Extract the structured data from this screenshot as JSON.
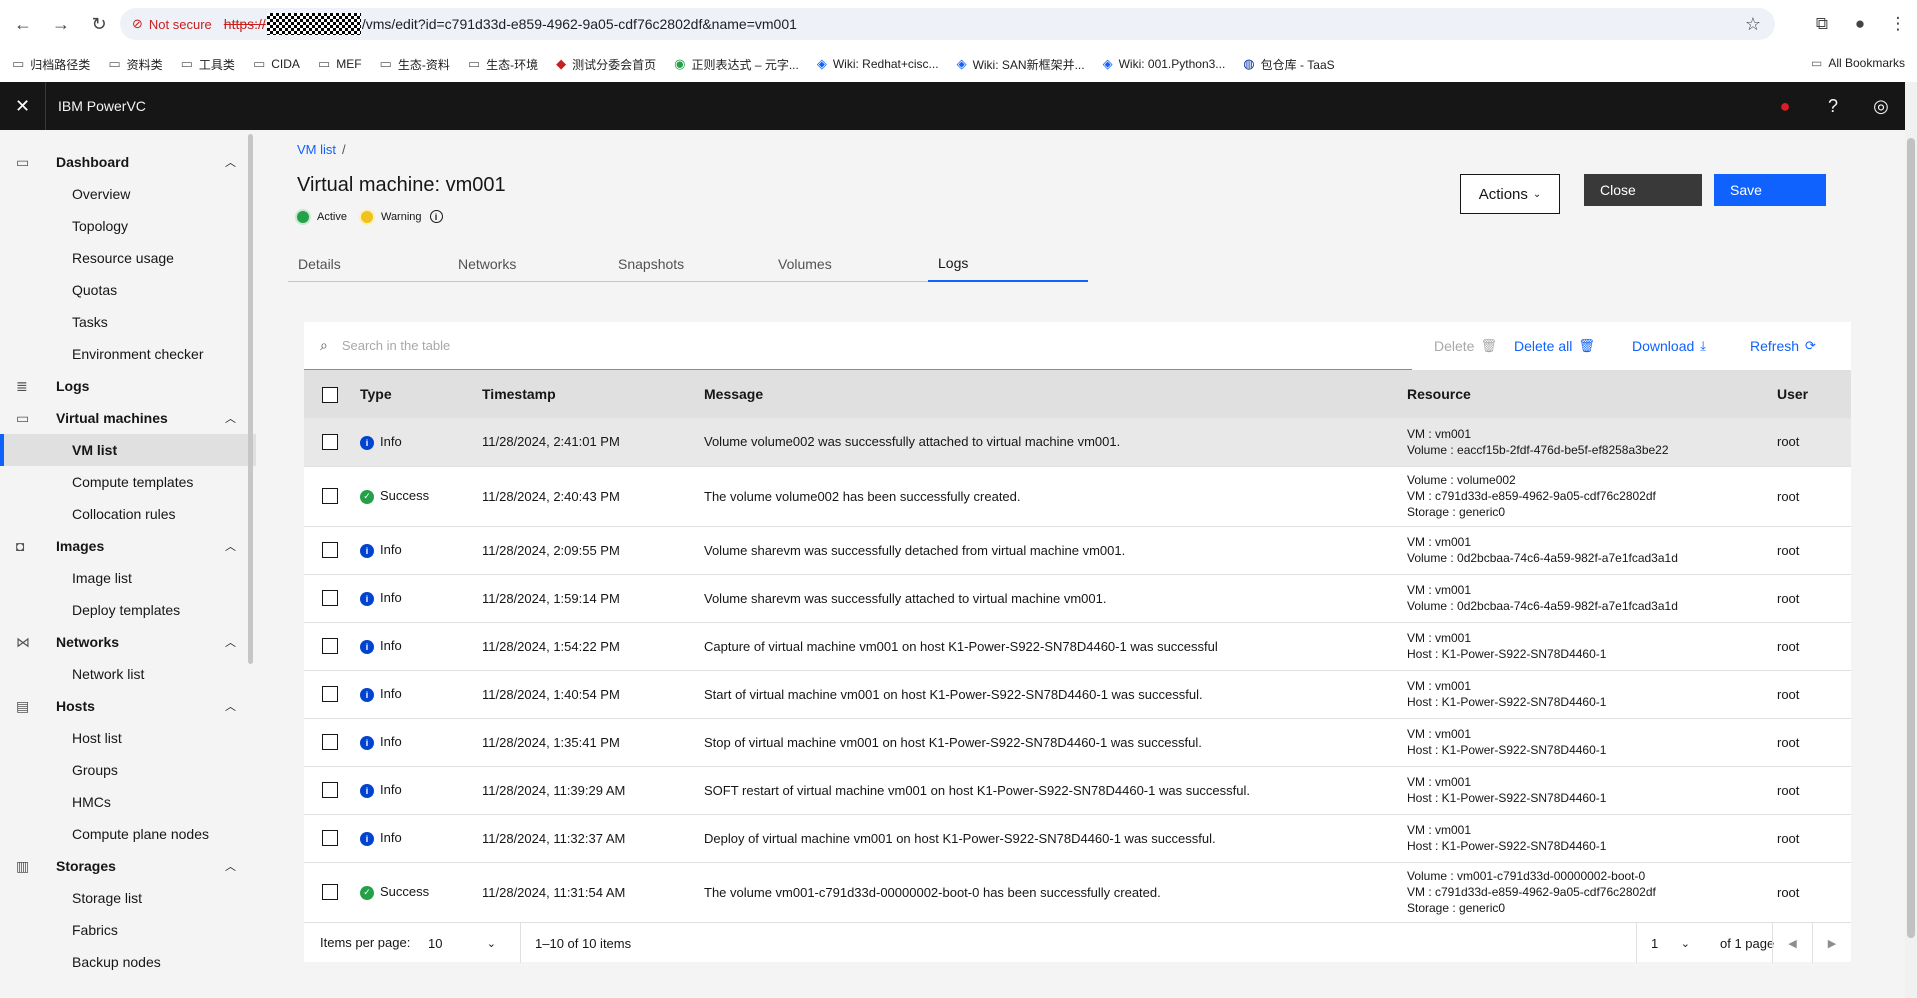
{
  "browser": {
    "not_secure": "Not secure",
    "url_scheme": "https://",
    "url_rest": "/vms/edit?id=c791d33d-e859-4962-9a05-cdf76c2802df&name=vm001",
    "bookmarks": [
      "归档路径类",
      "资料类",
      "工具类",
      "CIDA",
      "MEF",
      "生态-资料",
      "生态-环境",
      "测试分委会首页",
      "正则表达式 – 元字...",
      "Wiki: Redhat+cisc...",
      "Wiki: SAN新框架并...",
      "Wiki: 001.Python3...",
      "包仓库 - TaaS"
    ],
    "all_bookmarks": "All Bookmarks"
  },
  "header": {
    "title": "IBM PowerVC"
  },
  "sidebar": {
    "groups": [
      {
        "label": "Dashboard",
        "icon": "monitor-icon",
        "items": [
          "Overview",
          "Topology",
          "Resource usage",
          "Quotas",
          "Tasks",
          "Environment checker"
        ]
      },
      {
        "label": "Logs",
        "icon": "log-icon",
        "items": []
      },
      {
        "label": "Virtual machines",
        "icon": "vm-icon",
        "items": [
          "VM list",
          "Compute templates",
          "Collocation rules"
        ]
      },
      {
        "label": "Images",
        "icon": "camera-icon",
        "items": [
          "Image list",
          "Deploy templates"
        ]
      },
      {
        "label": "Networks",
        "icon": "network-icon",
        "items": [
          "Network list"
        ]
      },
      {
        "label": "Hosts",
        "icon": "host-icon",
        "items": [
          "Host list",
          "Groups",
          "HMCs",
          "Compute plane nodes"
        ]
      },
      {
        "label": "Storages",
        "icon": "storage-icon",
        "items": [
          "Storage list",
          "Fabrics",
          "Backup nodes"
        ]
      }
    ],
    "active_item": "VM list"
  },
  "main": {
    "breadcrumb": {
      "link": "VM list",
      "sep": "/"
    },
    "title": "Virtual machine: vm001",
    "status": {
      "active": "Active",
      "warning": "Warning"
    },
    "buttons": {
      "actions": "Actions",
      "close": "Close",
      "save": "Save"
    },
    "tabs": [
      "Details",
      "Networks",
      "Snapshots",
      "Volumes",
      "Logs"
    ],
    "active_tab": "Logs"
  },
  "table": {
    "search_placeholder": "Search in the table",
    "toolbar": {
      "delete": "Delete",
      "delete_all": "Delete all",
      "download": "Download",
      "refresh": "Refresh"
    },
    "columns": [
      "Type",
      "Timestamp",
      "Message",
      "Resource",
      "User"
    ],
    "rows": [
      {
        "type": "Info",
        "ts": "11/28/2024, 2:41:01 PM",
        "msg": "Volume volume002 was successfully attached to virtual machine vm001.",
        "res": [
          "VM : vm001",
          "Volume : eaccf15b-2fdf-476d-be5f-ef8258a3be22"
        ],
        "user": "root"
      },
      {
        "type": "Success",
        "ts": "11/28/2024, 2:40:43 PM",
        "msg": "The volume volume002 has been successfully created.",
        "res": [
          "Volume : volume002",
          "VM : c791d33d-e859-4962-9a05-cdf76c2802df",
          "Storage : generic0"
        ],
        "user": "root"
      },
      {
        "type": "Info",
        "ts": "11/28/2024, 2:09:55 PM",
        "msg": "Volume sharevm was successfully detached from virtual machine vm001.",
        "res": [
          "VM : vm001",
          "Volume : 0d2bcbaa-74c6-4a59-982f-a7e1fcad3a1d"
        ],
        "user": "root"
      },
      {
        "type": "Info",
        "ts": "11/28/2024, 1:59:14 PM",
        "msg": "Volume sharevm was successfully attached to virtual machine vm001.",
        "res": [
          "VM : vm001",
          "Volume : 0d2bcbaa-74c6-4a59-982f-a7e1fcad3a1d"
        ],
        "user": "root"
      },
      {
        "type": "Info",
        "ts": "11/28/2024, 1:54:22 PM",
        "msg": "Capture of virtual machine vm001 on host K1-Power-S922-SN78D4460-1 was successful",
        "res": [
          "VM : vm001",
          "Host : K1-Power-S922-SN78D4460-1"
        ],
        "user": "root"
      },
      {
        "type": "Info",
        "ts": "11/28/2024, 1:40:54 PM",
        "msg": "Start of virtual machine vm001 on host K1-Power-S922-SN78D4460-1 was successful.",
        "res": [
          "VM : vm001",
          "Host : K1-Power-S922-SN78D4460-1"
        ],
        "user": "root"
      },
      {
        "type": "Info",
        "ts": "11/28/2024, 1:35:41 PM",
        "msg": "Stop of virtual machine vm001 on host K1-Power-S922-SN78D4460-1 was successful.",
        "res": [
          "VM : vm001",
          "Host : K1-Power-S922-SN78D4460-1"
        ],
        "user": "root"
      },
      {
        "type": "Info",
        "ts": "11/28/2024, 11:39:29 AM",
        "msg": "SOFT restart of virtual machine vm001 on host K1-Power-S922-SN78D4460-1 was successful.",
        "res": [
          "VM : vm001",
          "Host : K1-Power-S922-SN78D4460-1"
        ],
        "user": "root"
      },
      {
        "type": "Info",
        "ts": "11/28/2024, 11:32:37 AM",
        "msg": "Deploy of virtual machine vm001 on host K1-Power-S922-SN78D4460-1 was successful.",
        "res": [
          "VM : vm001",
          "Host : K1-Power-S922-SN78D4460-1"
        ],
        "user": "root"
      },
      {
        "type": "Success",
        "ts": "11/28/2024, 11:31:54 AM",
        "msg": "The volume vm001-c791d33d-00000002-boot-0 has been successfully created.",
        "res": [
          "Volume : vm001-c791d33d-00000002-boot-0",
          "VM : c791d33d-e859-4962-9a05-cdf76c2802df",
          "Storage : generic0"
        ],
        "user": "root"
      }
    ],
    "pager": {
      "items_per_page_label": "Items per page:",
      "items_per_page": "10",
      "range": "1–10 of 10 items",
      "page": "1",
      "of_pages": "of 1 page"
    }
  }
}
